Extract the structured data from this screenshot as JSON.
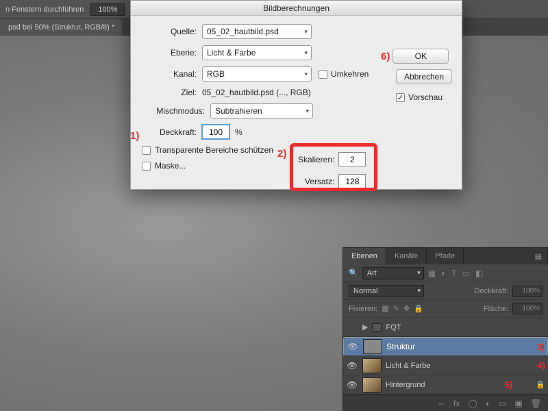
{
  "toolbar": {
    "durchfuehren": "n Fenstern durchführen",
    "zoom": "100%"
  },
  "tab": {
    "title": "psd bei 50% (Struktur, RGB/8) *"
  },
  "dialog": {
    "title": "Bildberechnungen",
    "quelle_label": "Quelle:",
    "quelle_value": "05_02_hautbild.psd",
    "ebene_label": "Ebene:",
    "ebene_value": "Licht & Farbe",
    "kanal_label": "Kanal:",
    "kanal_value": "RGB",
    "umkehren_label": "Umkehren",
    "ziel_label": "Ziel:",
    "ziel_value": "05_02_hautbild.psd (..., RGB)",
    "mischmodus_label": "Mischmodus:",
    "mischmodus_value": "Subtrahieren",
    "deckkraft_label": "Deckkraft:",
    "deckkraft_value": "100",
    "deckkraft_unit": "%",
    "transparente_label": "Transparente Bereiche schützen",
    "maske_label": "Maske...",
    "skalieren_label": "Skalieren:",
    "skalieren_value": "2",
    "versatz_label": "Versatz:",
    "versatz_value": "128",
    "ok": "OK",
    "abbrechen": "Abbrechen",
    "vorschau_label": "Vorschau"
  },
  "annotations": {
    "a1": "1)",
    "a2": "2)",
    "a3": "3)",
    "a4": "4)",
    "a5": "5)",
    "a6": "6)"
  },
  "panel": {
    "tabs": {
      "ebenen": "Ebenen",
      "kanaele": "Kanäle",
      "pfade": "Pfade"
    },
    "kind_label": "Art",
    "blend": "Normal",
    "deckkraft_lbl": "Deckkraft:",
    "deckkraft_val": "100%",
    "fixieren_lbl": "Fixieren:",
    "flaeche_lbl": "Fläche:",
    "flaeche_val": "100%",
    "layers": {
      "fqt": "FQT",
      "struktur": "Struktur",
      "licht": "Licht & Farbe",
      "hintergrund": "Hintergrund"
    }
  }
}
